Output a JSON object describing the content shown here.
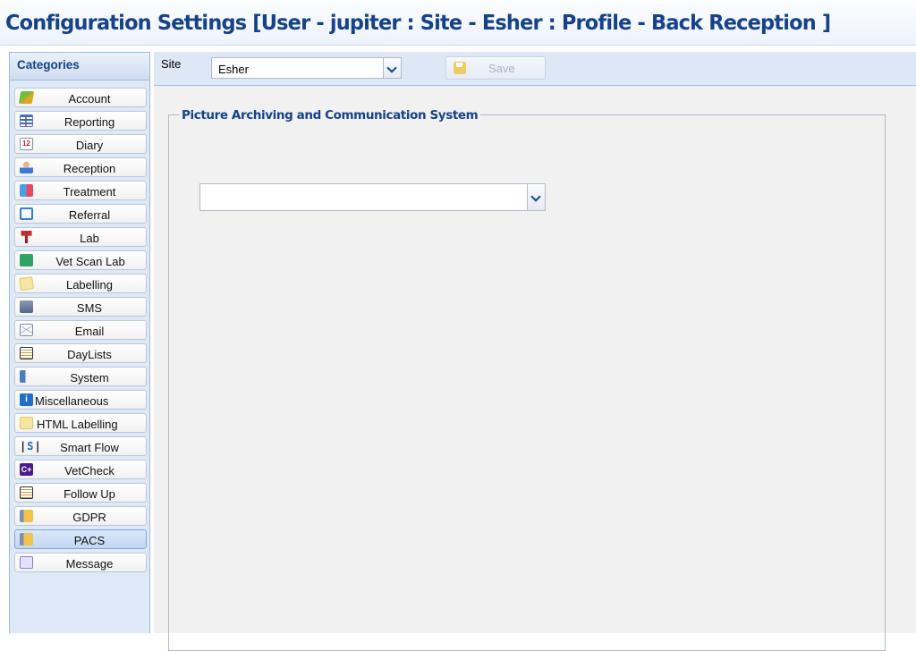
{
  "window": {
    "title": "Configuration Settings [User - jupiter : Site - Esher : Profile - Back Reception ]"
  },
  "sidebar": {
    "header": "Categories",
    "items": [
      {
        "label": "Account",
        "icon": "account-icon"
      },
      {
        "label": "Reporting",
        "icon": "reporting-icon"
      },
      {
        "label": "Diary",
        "icon": "calendar-icon"
      },
      {
        "label": "Reception",
        "icon": "person-icon"
      },
      {
        "label": "Treatment",
        "icon": "treatment-icon"
      },
      {
        "label": "Referral",
        "icon": "magnifier-icon"
      },
      {
        "label": "Lab",
        "icon": "lab-icon"
      },
      {
        "label": "Vet Scan Lab",
        "icon": "vetscan-icon"
      },
      {
        "label": "Labelling",
        "icon": "label-icon"
      },
      {
        "label": "SMS",
        "icon": "phone-icon"
      },
      {
        "label": "Email",
        "icon": "envelope-icon"
      },
      {
        "label": "DayLists",
        "icon": "list-icon"
      },
      {
        "label": "System",
        "icon": "system-icon"
      },
      {
        "label": "Miscellaneous",
        "icon": "info-icon"
      },
      {
        "label": "HTML Labelling",
        "icon": "html-label-icon"
      },
      {
        "label": "Smart Flow",
        "icon": "smart-flow-icon"
      },
      {
        "label": "VetCheck",
        "icon": "vetcheck-icon"
      },
      {
        "label": "Follow Up",
        "icon": "list-icon"
      },
      {
        "label": "GDPR",
        "icon": "gdpr-icon"
      },
      {
        "label": "PACS",
        "icon": "gdpr-icon"
      },
      {
        "label": "Message",
        "icon": "speech-bubble-icon"
      }
    ],
    "selected": "PACS"
  },
  "toolbar": {
    "site_label": "Site",
    "site_value": "Esher",
    "save_label": "Save"
  },
  "main": {
    "section_title": "Picture Archiving and Communication System",
    "pacs_value": ""
  },
  "colors": {
    "title_text": "#15428b",
    "panel_border": "#99bbe8",
    "sidebar_bg": "#dfe8f6",
    "content_bg": "#f1f1f1"
  }
}
